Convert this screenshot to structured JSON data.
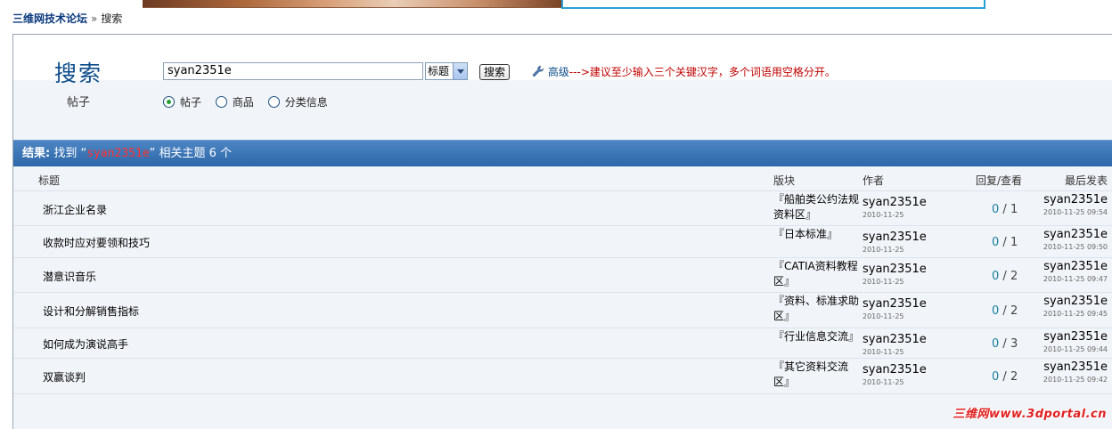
{
  "breadcrumb": {
    "home": "三维网技术论坛",
    "separator": "»",
    "current": "搜索"
  },
  "search": {
    "title": "搜索",
    "subtitle": "帖子",
    "query": "syan2351e",
    "field_select": "标题",
    "button": "搜索",
    "advanced_link": "高级",
    "advanced_hint": "--->建议至少输入三个关键汉字，多个词语用空格分开。",
    "types": [
      {
        "label": "帖子",
        "selected": true
      },
      {
        "label": "商品",
        "selected": false
      },
      {
        "label": "分类信息",
        "selected": false
      }
    ]
  },
  "results": {
    "label": "结果:",
    "prefix": "找到 “",
    "query": "syan2351e",
    "suffix": "” 相关主题 6 个"
  },
  "columns": {
    "title": "标题",
    "forum": "版块",
    "author": "作者",
    "stats": "回复/查看",
    "last": "最后发表"
  },
  "rows": [
    {
      "title": "浙江企业名录",
      "forum": "『船舶类公约法规资料区』",
      "author": "syan2351e",
      "date": "2010-11-25",
      "replies": "0",
      "sep": "/",
      "views": "1",
      "last_author": "syan2351e",
      "last_time": "2010-11-25 09:54"
    },
    {
      "title": "收款时应对要领和技巧",
      "forum": "『日本标准』",
      "author": "syan2351e",
      "date": "2010-11-25",
      "replies": "0",
      "sep": "/",
      "views": "1",
      "last_author": "syan2351e",
      "last_time": "2010-11-25 09:50"
    },
    {
      "title": "潜意识音乐",
      "forum": "『CATIA资料教程区』",
      "author": "syan2351e",
      "date": "2010-11-25",
      "replies": "0",
      "sep": "/",
      "views": "2",
      "last_author": "syan2351e",
      "last_time": "2010-11-25 09:47"
    },
    {
      "title": "设计和分解销售指标",
      "forum": "『资料、标准求助区』",
      "author": "syan2351e",
      "date": "2010-11-25",
      "replies": "0",
      "sep": "/",
      "views": "2",
      "last_author": "syan2351e",
      "last_time": "2010-11-25 09:45"
    },
    {
      "title": "如何成为演说高手",
      "forum": "『行业信息交流』",
      "author": "syan2351e",
      "date": "2010-11-25",
      "replies": "0",
      "sep": "/",
      "views": "3",
      "last_author": "syan2351e",
      "last_time": "2010-11-25 09:44"
    },
    {
      "title": "双赢谈判",
      "forum": "『其它资料交流区』",
      "author": "syan2351e",
      "date": "2010-11-25",
      "replies": "0",
      "sep": "/",
      "views": "2",
      "last_author": "syan2351e",
      "last_time": "2010-11-25 09:42"
    }
  ],
  "watermark": "三维网www.3dportal.cn"
}
